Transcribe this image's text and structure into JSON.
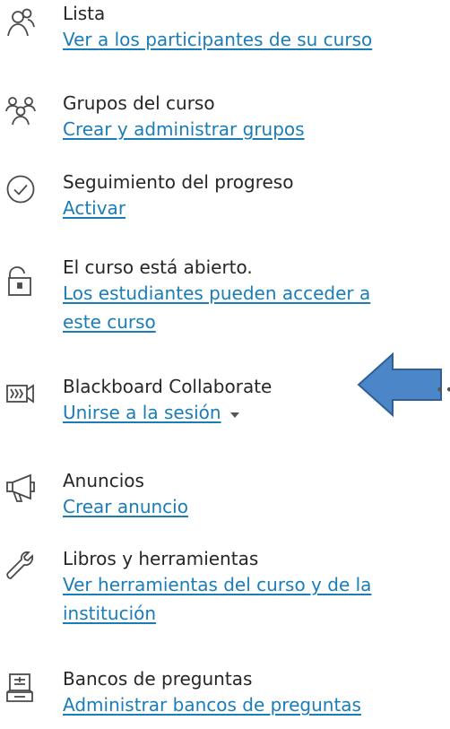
{
  "items": [
    {
      "title": "Lista",
      "link": "Ver a los participantes de su curso"
    },
    {
      "title": "Grupos del curso",
      "link": "Crear y administrar grupos"
    },
    {
      "title": "Seguimiento del progreso",
      "link": "Activar"
    },
    {
      "title": "El curso está abierto.",
      "link_line1": "Los estudiantes pueden acceder a",
      "link_line2": "este curso"
    },
    {
      "title": "Blackboard Collaborate",
      "link": "Unirse a la sesión"
    },
    {
      "title": "Anuncios",
      "link": "Crear anuncio"
    },
    {
      "title": "Libros y herramientas",
      "link_line1": "Ver herramientas del curso y de la",
      "link_line2": "institución"
    },
    {
      "title": "Bancos de preguntas",
      "link": "Administrar bancos de preguntas"
    }
  ],
  "colors": {
    "link": "#1a7db8",
    "text": "#262626",
    "icon": "#4a4a4a",
    "arrow_fill": "#4a86c8",
    "arrow_stroke": "#2f5f96"
  },
  "icons": [
    "roster-icon",
    "groups-icon",
    "progress-check-icon",
    "unlock-icon",
    "collaborate-icon",
    "megaphone-icon",
    "wrench-icon",
    "question-bank-icon"
  ]
}
